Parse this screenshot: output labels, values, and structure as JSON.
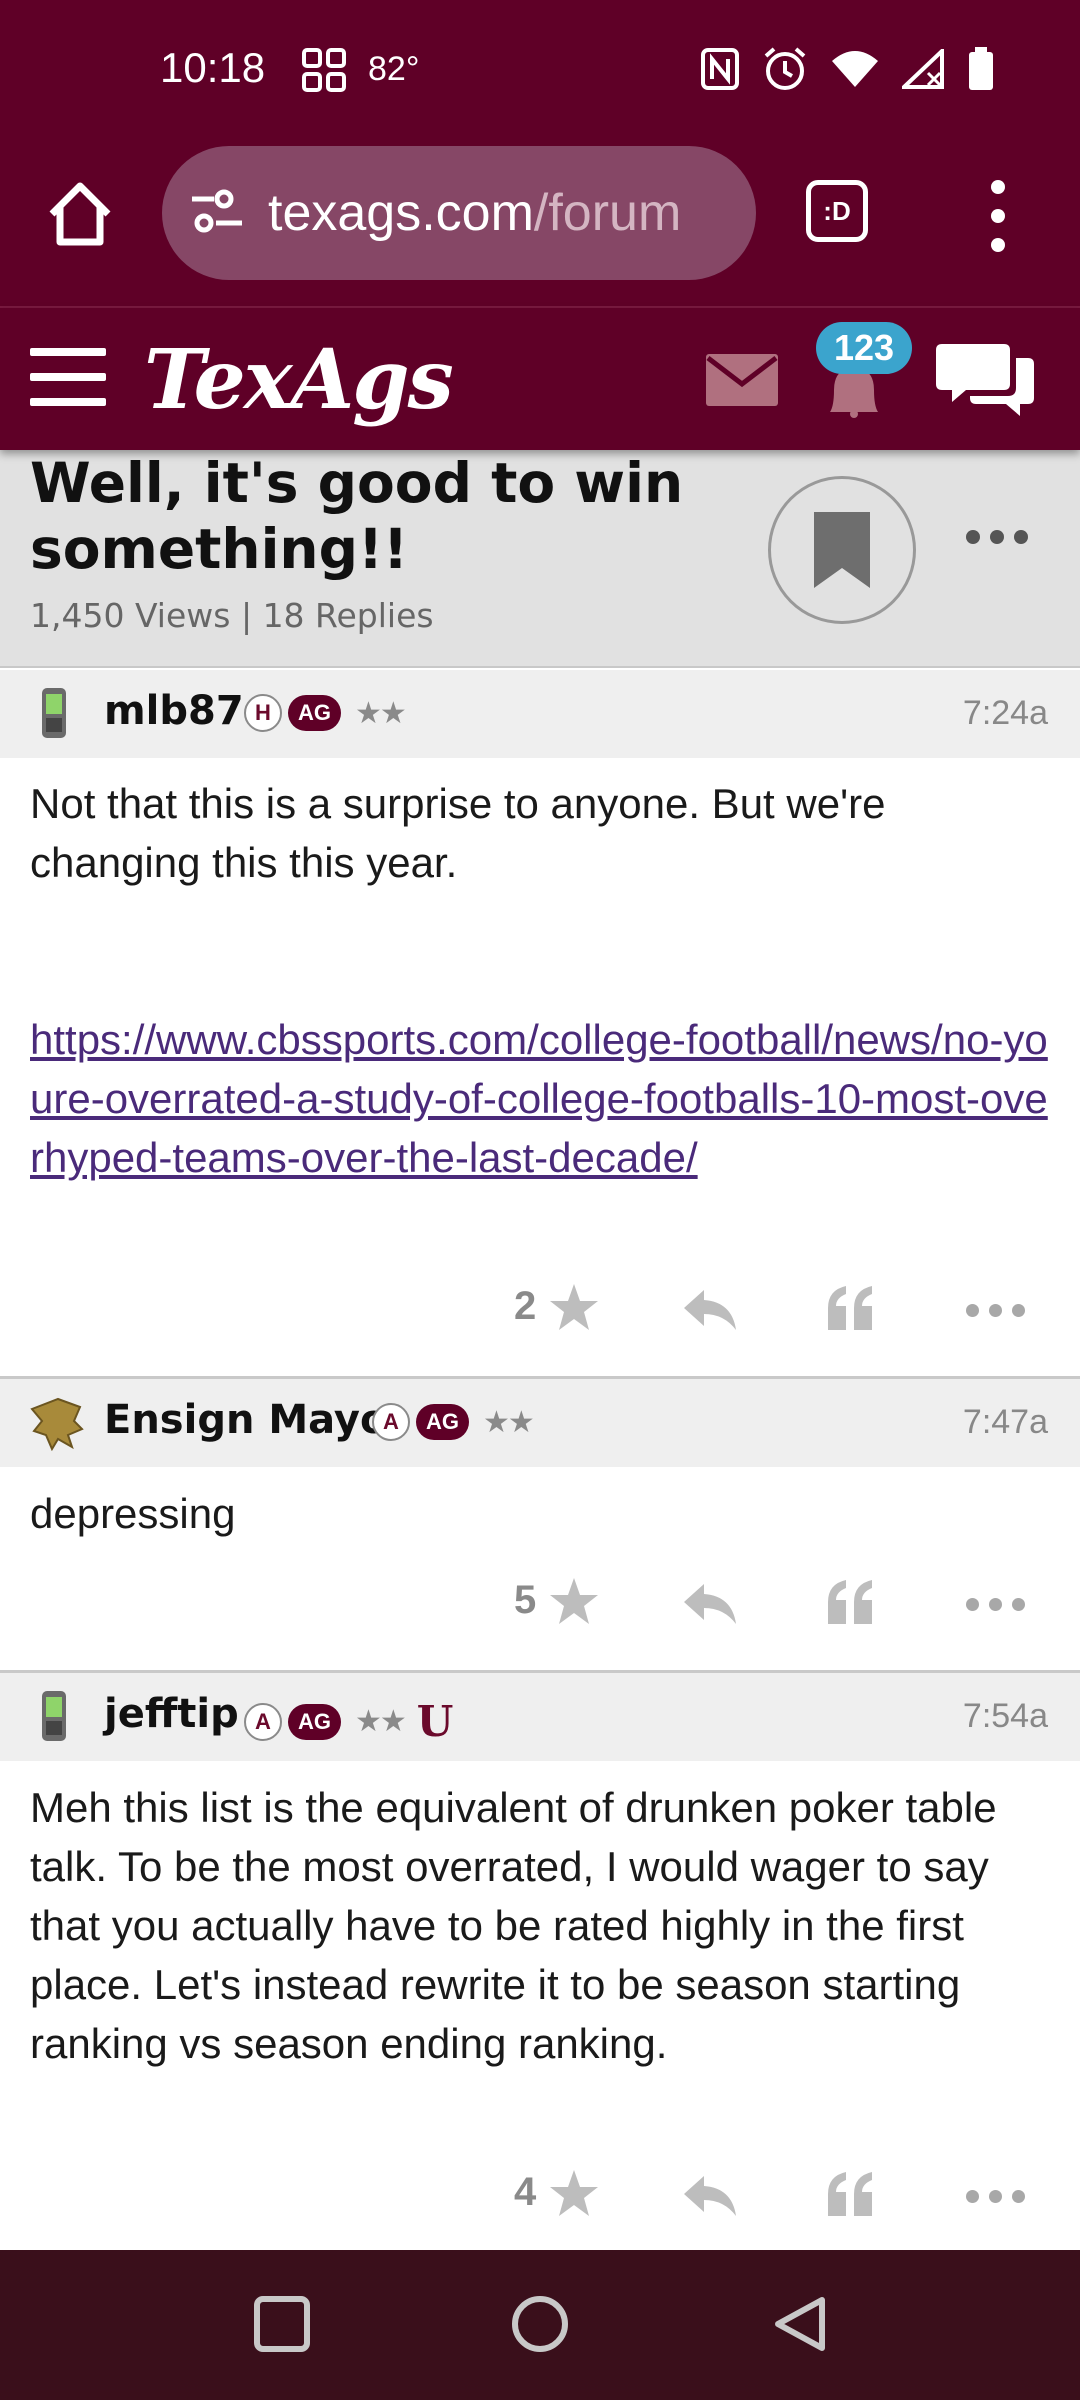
{
  "status_bar": {
    "time": "10:18",
    "temperature": "82°",
    "icons": [
      "grid-icon",
      "nfc-icon",
      "alarm-icon",
      "wifi-icon",
      "signal-icon",
      "battery-icon"
    ]
  },
  "browser": {
    "url_host": "texags.com",
    "url_path": "/forum",
    "tabs_label": ":D"
  },
  "site": {
    "logo": "TexAgs",
    "notification_count": "123"
  },
  "thread": {
    "title": "Well, it's good to win something!!",
    "meta": "1,450 Views | 18 Replies"
  },
  "posts": [
    {
      "username": "mlb87",
      "badge_1": "H",
      "badge_ag": "AG",
      "stars": "★★",
      "time": "7:24a",
      "text": "Not that this is a surprise to anyone. But we're changing this this year.",
      "link": "https://www.cbssports.com/college-football/news/no-youre-overrated-a-study-of-college-footballs-10-most-overhyped-teams-over-the-last-decade/",
      "star_count": "2"
    },
    {
      "username": "Ensign Mayo",
      "badge_1": "A",
      "badge_ag": "AG",
      "stars": "★★",
      "time": "7:47a",
      "text": "depressing",
      "star_count": "5"
    },
    {
      "username": "jefftip",
      "badge_1": "A",
      "badge_ag": "AG",
      "stars": "★★",
      "badge_u": "U",
      "time": "7:54a",
      "text": "Meh this list is the equivalent of drunken poker table talk. To be the most overrated, I would wager to say that you actually have to be rated highly in the first place. Let's instead rewrite it to be season starting ranking vs season ending ranking.",
      "star_count": "4"
    }
  ],
  "colors": {
    "maroon": "#5f0027",
    "nav_dark": "#3a0f1b",
    "badge_blue": "#3ba4cd",
    "link_purple": "#4a2a7a"
  }
}
